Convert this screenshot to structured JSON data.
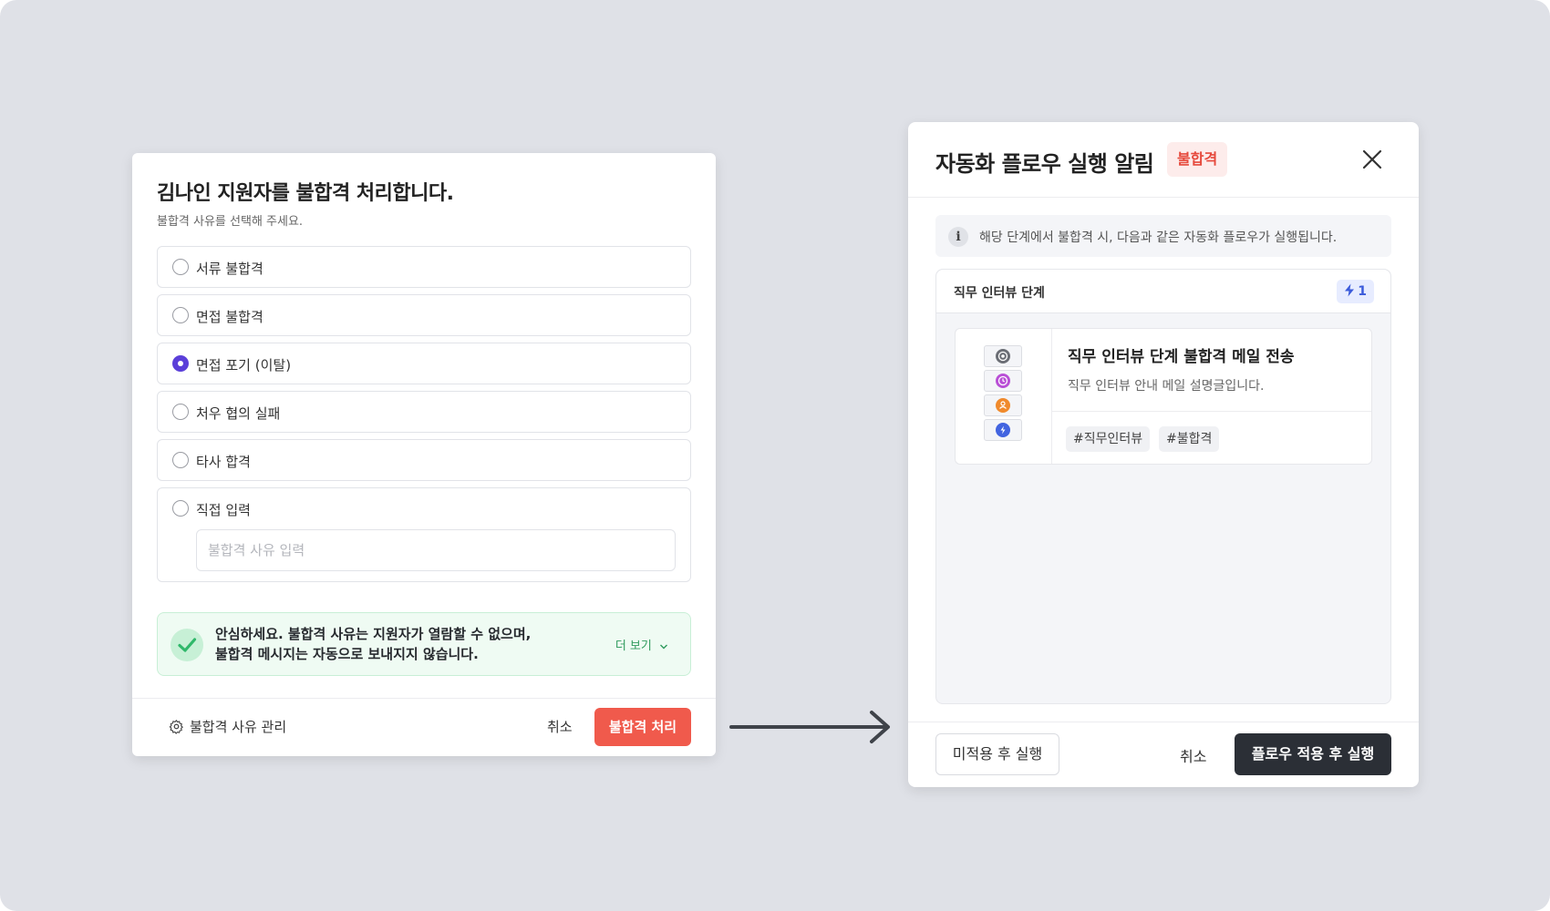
{
  "left_modal": {
    "title": "김나인 지원자를 불합격 처리합니다.",
    "subtitle": "불합격 사유를 선택해 주세요.",
    "options": [
      {
        "label": "서류 불합격",
        "checked": false
      },
      {
        "label": "면접 불합격",
        "checked": false
      },
      {
        "label": "면접 포기 (이탈)",
        "checked": true
      },
      {
        "label": "처우 협의 실패",
        "checked": false
      },
      {
        "label": "타사 합격",
        "checked": false
      },
      {
        "label": "직접 입력",
        "checked": false
      }
    ],
    "reason_input": {
      "placeholder": "불합격 사유 입력",
      "value": ""
    },
    "notice": {
      "line1": "안심하세요. 불합격 사유는 지원자가 열람할 수 없으며,",
      "line2": "불합격 메시지는 자동으로 보내지지 않습니다.",
      "more_label": "더 보기",
      "icon": "check-icon"
    },
    "footer": {
      "manage_label": "불합격 사유 관리",
      "cancel_label": "취소",
      "submit_label": "불합격 처리"
    }
  },
  "right_modal": {
    "title": "자동화 플로우 실행 알림",
    "badge": "불합격",
    "info_text": "해당 단계에서 불합격 시, 다음과 같은 자동화 플로우가 실행됩니다.",
    "stage": {
      "name": "직무 인터뷰 단계",
      "count": "1"
    },
    "flow": {
      "title": "직무 인터뷰 단계 불합격 메일 전송",
      "description": "직무 인터뷰 안내 메일 설명글입니다.",
      "tags": [
        "#직무인터뷰",
        "#불합격"
      ],
      "icons": [
        "target-icon",
        "clock-icon",
        "user-icon",
        "bolt-icon"
      ]
    },
    "footer": {
      "skip_label": "미적용 후 실행",
      "cancel_label": "취소",
      "apply_label": "플로우 적용 후 실행"
    }
  },
  "colors": {
    "background": "#dfe1e7",
    "radio_checked": "#5b3fd9",
    "reject_button": "#f05a4c",
    "notice_bg": "#effbf3",
    "success_green": "#2fb86a",
    "badge_red": "#e6493c",
    "dark_button": "#2b2f36",
    "chip_blue": "#3b5bdb"
  }
}
